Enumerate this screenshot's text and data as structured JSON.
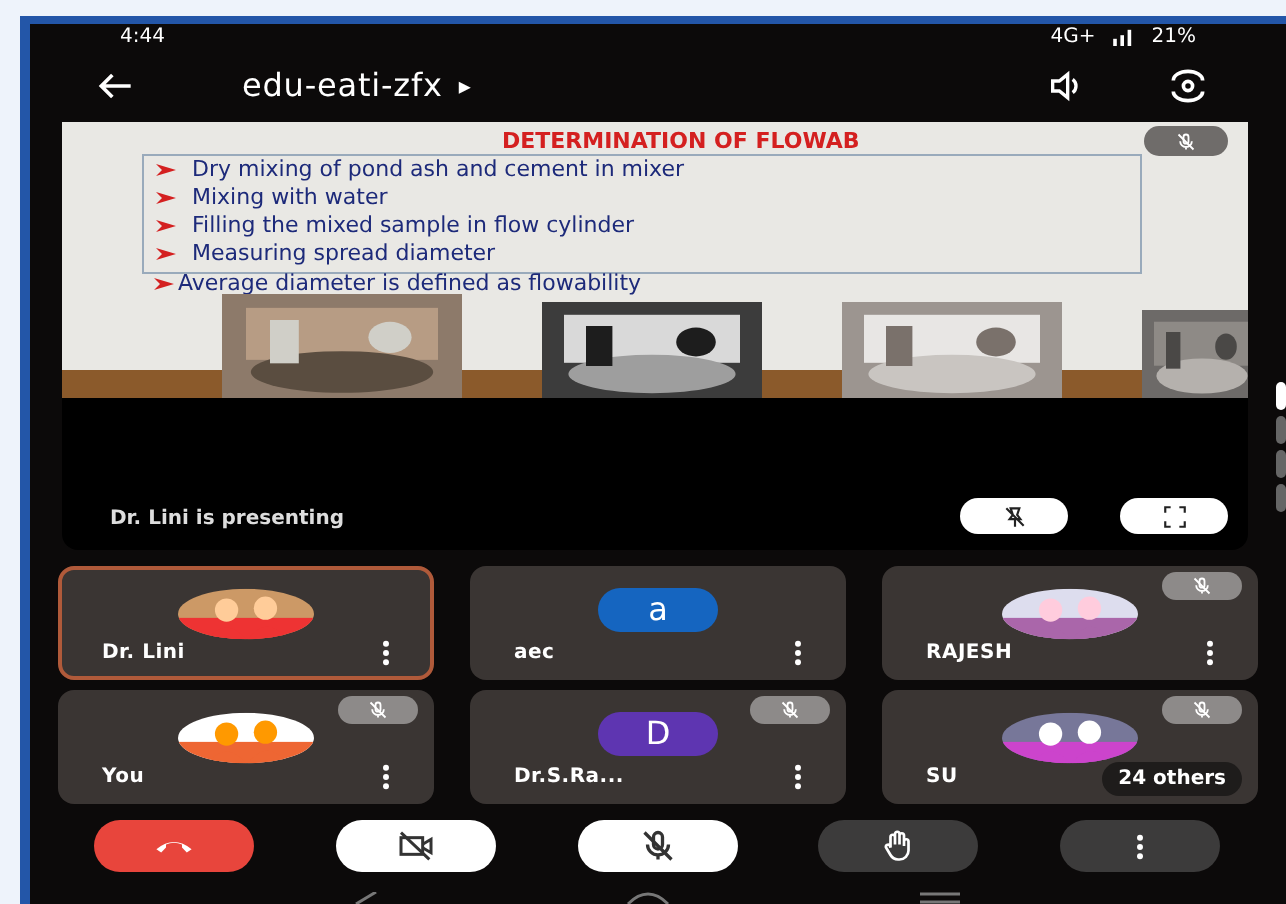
{
  "status_bar": {
    "time": "4:44",
    "network": "4G+",
    "battery": "21%"
  },
  "top_bar": {
    "meeting_code": "edu-eati-zfx",
    "play_mark": "▸"
  },
  "presentation": {
    "slide": {
      "title": "DETERMINATION OF FLOWAB",
      "bullets": [
        "Dry mixing of pond ash and cement in mixer",
        "Mixing with water",
        "Filling the mixed sample in flow cylinder",
        "Measuring spread diameter"
      ],
      "footer_bullet": "Average diameter is defined as flowability",
      "photos": [
        {
          "kind": "picture"
        },
        {
          "kind": "picture"
        },
        {
          "kind": "picture"
        },
        {
          "kind": "picture"
        }
      ]
    },
    "presenter_label": "Dr. Lini is presenting",
    "pinned": false
  },
  "participants": [
    {
      "name": "Dr. Lini",
      "muted": false,
      "selected": true
    },
    {
      "name": "aec",
      "kind": "letter",
      "letter": "a",
      "color": "#1565c0",
      "muted": false,
      "selected": false
    },
    {
      "name": "RAJESH",
      "muted": true,
      "selected": false
    },
    {
      "name": "You",
      "muted": true,
      "selected": false
    },
    {
      "name": "Dr.S.Ra...",
      "kind": "letter",
      "letter": "D",
      "color": "#5e35b1",
      "muted": true,
      "selected": false
    },
    {
      "name": "SU",
      "muted": true,
      "selected": false,
      "others": "24 others"
    }
  ],
  "controls": [
    {
      "kind": "end-call"
    },
    {
      "kind": "camera",
      "on": false
    },
    {
      "kind": "mic",
      "on": false
    },
    {
      "kind": "hand"
    },
    {
      "kind": "more"
    }
  ]
}
